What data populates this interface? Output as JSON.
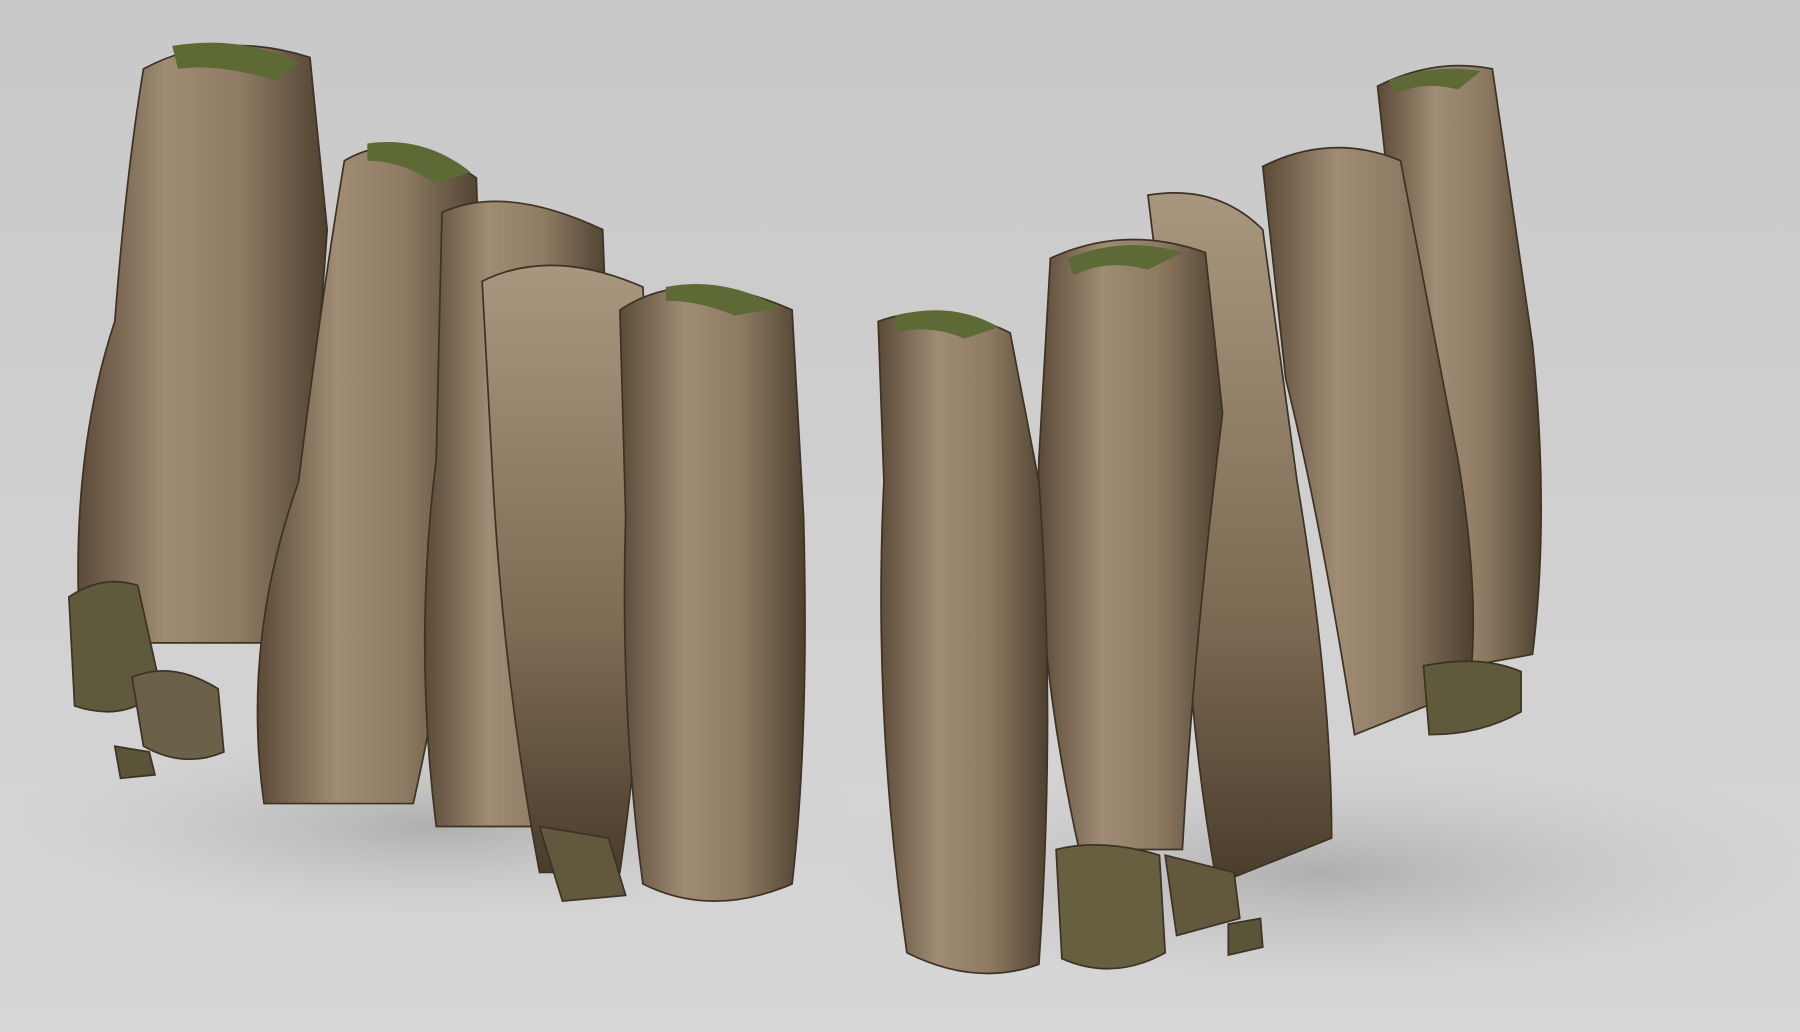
{
  "scene": {
    "subject": "rock-cliff-pillars",
    "colors": {
      "background_top": "#c9c9c9",
      "background_bottom": "#d6d6d6",
      "rock_light": "#a89680",
      "rock_mid": "#86735c",
      "rock_dark": "#4e4130",
      "moss": "#5d6a35",
      "shadow": "#b4b4b4"
    }
  }
}
